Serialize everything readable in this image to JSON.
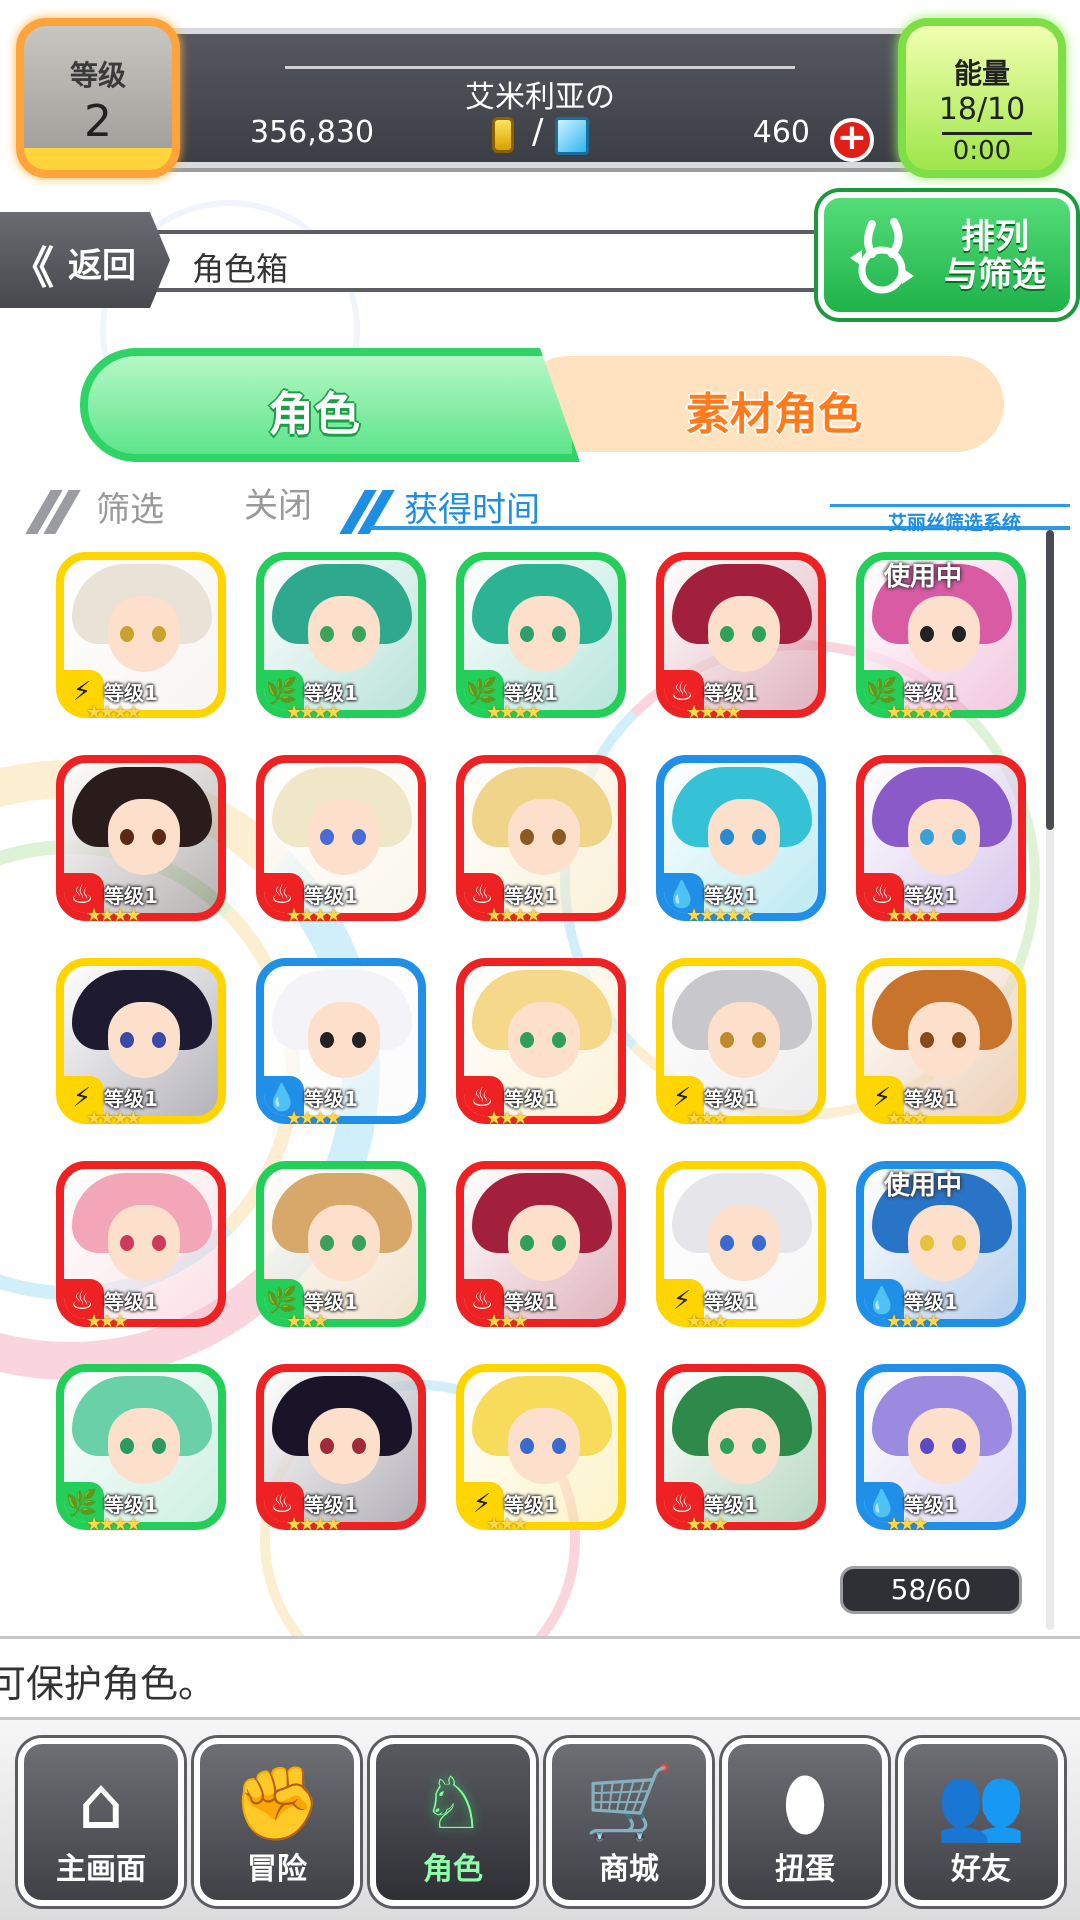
{
  "header": {
    "level_label": "等级",
    "level_value": "2",
    "player_name": "艾米利亚の",
    "gold": "356,830",
    "currency_separator": "/",
    "gems": "460",
    "energy_label": "能量",
    "energy_value": "18/10",
    "energy_timer": "0:00"
  },
  "nav": {
    "back_arrows": "《",
    "back_label": "返回",
    "page_title": "角色箱",
    "sort_label_line1": "排列",
    "sort_label_line2": "与筛选"
  },
  "tabs": {
    "characters": "角色",
    "materials": "素材角色"
  },
  "filter": {
    "filter_label": "筛选",
    "filter_state": "关闭",
    "sort_key": "获得时间",
    "system_label": "艾丽丝筛选系统"
  },
  "characters": [
    {
      "element": "thunder",
      "level": "等级1",
      "stars": "★★★★",
      "in_use": "",
      "frame": "#ffd500",
      "hair": "#e9e2d6",
      "eye": "#c9a12c"
    },
    {
      "element": "wind",
      "level": "等级1",
      "stars": "★★★★",
      "in_use": "",
      "frame": "#23cf58",
      "hair": "#2fa98d",
      "eye": "#3aa35a"
    },
    {
      "element": "wind",
      "level": "等级1",
      "stars": "★★★★",
      "in_use": "",
      "frame": "#23cf58",
      "hair": "#2bb394",
      "eye": "#2e9e6b"
    },
    {
      "element": "fire",
      "level": "等级1",
      "stars": "★★★★",
      "in_use": "",
      "frame": "#ee2222",
      "hair": "#a2203c",
      "eye": "#2ea05a"
    },
    {
      "element": "wind",
      "level": "等级1",
      "stars": "★★★★★",
      "in_use": "使用中",
      "frame": "#23cf58",
      "hair": "#d95ba4",
      "eye": "#222222"
    },
    {
      "element": "fire",
      "level": "等级1",
      "stars": "★★★★",
      "in_use": "",
      "frame": "#ee2222",
      "hair": "#2a1c1a",
      "eye": "#5a2a14"
    },
    {
      "element": "fire",
      "level": "等级1",
      "stars": "★★★★",
      "in_use": "",
      "frame": "#ee2222",
      "hair": "#f0e6c8",
      "eye": "#4a6ad6"
    },
    {
      "element": "fire",
      "level": "等级1",
      "stars": "★★★★",
      "in_use": "",
      "frame": "#ee2222",
      "hair": "#f0d48a",
      "eye": "#8a5a20"
    },
    {
      "element": "water",
      "level": "等级1",
      "stars": "★★★★★",
      "in_use": "",
      "frame": "#1f8fe8",
      "hair": "#36c2d6",
      "eye": "#2a8ad0"
    },
    {
      "element": "fire",
      "level": "等级1",
      "stars": "★★★★",
      "in_use": "",
      "frame": "#ee2222",
      "hair": "#8a5ac8",
      "eye": "#3aa0d8"
    },
    {
      "element": "thunder",
      "level": "等级1",
      "stars": "★★★★",
      "in_use": "",
      "frame": "#ffd500",
      "hair": "#1e1a30",
      "eye": "#3a4aa8"
    },
    {
      "element": "water",
      "level": "等级1",
      "stars": "★★★★",
      "in_use": "",
      "frame": "#1f8fe8",
      "hair": "#f4f4f8",
      "eye": "#222222"
    },
    {
      "element": "fire",
      "level": "等级1",
      "stars": "★★★",
      "in_use": "",
      "frame": "#ee2222",
      "hair": "#f6d88a",
      "eye": "#2ea05a"
    },
    {
      "element": "thunder",
      "level": "等级1",
      "stars": "★★★",
      "in_use": "",
      "frame": "#ffd500",
      "hair": "#c8c8cc",
      "eye": "#c08a2a"
    },
    {
      "element": "thunder",
      "level": "等级1",
      "stars": "★★★",
      "in_use": "",
      "frame": "#ffd500",
      "hair": "#c9742c",
      "eye": "#8a4a1a"
    },
    {
      "element": "fire",
      "level": "等级1",
      "stars": "★★★",
      "in_use": "",
      "frame": "#ee2222",
      "hair": "#f3a6b8",
      "eye": "#d03a5a"
    },
    {
      "element": "wind",
      "level": "等级1",
      "stars": "★★★",
      "in_use": "",
      "frame": "#23cf58",
      "hair": "#d8a86a",
      "eye": "#3aa05a"
    },
    {
      "element": "fire",
      "level": "等级1",
      "stars": "★★★",
      "in_use": "",
      "frame": "#ee2222",
      "hair": "#a2203c",
      "eye": "#2ea05a"
    },
    {
      "element": "thunder",
      "level": "等级1",
      "stars": "★★★",
      "in_use": "",
      "frame": "#ffd500",
      "hair": "#e6e6ea",
      "eye": "#3a6ad0"
    },
    {
      "element": "water",
      "level": "等级1",
      "stars": "★★★★",
      "in_use": "使用中",
      "frame": "#1f8fe8",
      "hair": "#2a74c8",
      "eye": "#e8c040"
    },
    {
      "element": "wind",
      "level": "等级1",
      "stars": "★★★★",
      "in_use": "",
      "frame": "#23cf58",
      "hair": "#6ad0a8",
      "eye": "#2a9a60"
    },
    {
      "element": "fire",
      "level": "等级1",
      "stars": "★★★★",
      "in_use": "",
      "frame": "#ee2222",
      "hair": "#1a1428",
      "eye": "#a02a3a"
    },
    {
      "element": "thunder",
      "level": "等级1",
      "stars": "★★★",
      "in_use": "",
      "frame": "#ffd500",
      "hair": "#f6dc5a",
      "eye": "#3a6ad0"
    },
    {
      "element": "fire",
      "level": "等级1",
      "stars": "★★★",
      "in_use": "",
      "frame": "#ee2222",
      "hair": "#2e8a4a",
      "eye": "#2ea05a"
    },
    {
      "element": "water",
      "level": "等级1",
      "stars": "★★★",
      "in_use": "",
      "frame": "#1f8fe8",
      "hair": "#9a8ae0",
      "eye": "#5a4ac8"
    }
  ],
  "element_icons": {
    "fire": "♨",
    "water": "💧",
    "wind": "🌿",
    "thunder": "⚡"
  },
  "element_colors": {
    "fire": "#ee2222",
    "water": "#1f8fe8",
    "wind": "#23cf58",
    "thunder": "#ffd500"
  },
  "counter": "58/60",
  "message": "可保护角色。",
  "footer": [
    {
      "label": "主画面",
      "icon": "home-icon",
      "glyph": "⌂",
      "active": false
    },
    {
      "label": "冒险",
      "icon": "handshake-icon",
      "glyph": "✊",
      "active": false
    },
    {
      "label": "角色",
      "icon": "bunny-icon",
      "glyph": "♘",
      "active": true
    },
    {
      "label": "商城",
      "icon": "cart-icon",
      "glyph": "🛒",
      "active": false
    },
    {
      "label": "扭蛋",
      "icon": "egg-icon",
      "glyph": "⬮",
      "active": false
    },
    {
      "label": "好友",
      "icon": "friends-icon",
      "glyph": "👥",
      "active": false
    }
  ]
}
